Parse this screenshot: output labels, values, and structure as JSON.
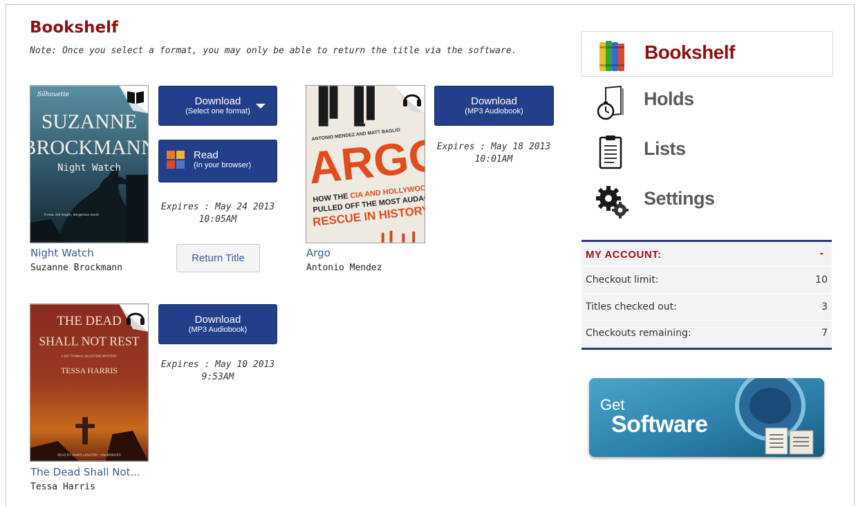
{
  "page": {
    "title": "Bookshelf",
    "note": "Note: Once you select a format, you may only be able to return the title via the software."
  },
  "books": [
    {
      "title": "Night Watch",
      "author": "Suzanne Brockmann",
      "format_icon": "ebook-icon",
      "cover": {
        "line1": "SUZANNE",
        "line2": "BROCKMANN",
        "line3": "Night Watch",
        "publisher": "Silhouette",
        "tag": "A new, full-length, dangerous novel"
      },
      "download": {
        "label": "Download",
        "sub": "(Select one format)"
      },
      "read": {
        "label": "Read",
        "sub": "(In your browser)"
      },
      "expires": {
        "line1": "Expires : May 24 2013",
        "line2": "10:05AM"
      },
      "return_label": "Return Title"
    },
    {
      "title": "Argo",
      "author": "Antonio Mendez",
      "format_icon": "headphones-icon",
      "cover": {
        "authors": "ANTONIO MENDEZ AND MATT BAGLIO",
        "big": "ARGO",
        "sub1a": "HOW THE ",
        "sub1b": "CIA AND HOLLYWOOD",
        "sub2": "PULLED OFF THE MOST AUDACIOUS",
        "sub3": "RESCUE IN HISTORY"
      },
      "download": {
        "label": "Download",
        "sub": "(MP3 Audiobook)"
      },
      "expires": {
        "line1": "Expires : May 18 2013",
        "line2": "10:01AM"
      }
    },
    {
      "title": "The Dead Shall Not...",
      "author": "Tessa Harris",
      "format_icon": "headphones-icon",
      "cover": {
        "line1": "THE DEAD",
        "line2": "SHALL NOT REST",
        "line3": "A DR. THOMAS SILKSTONE MYSTERY",
        "line4": "TESSA HARRIS",
        "reader": "READ BY JAMES LANGTON · UNABRIDGED"
      },
      "download": {
        "label": "Download",
        "sub": "(MP3 Audiobook)"
      },
      "expires": {
        "line1": "Expires : May 10 2013",
        "line2": "9:53AM"
      }
    }
  ],
  "sidebar": {
    "nav": [
      {
        "label": "Bookshelf",
        "icon": "books-icon",
        "active": true
      },
      {
        "label": "Holds",
        "icon": "stopwatch-book-icon",
        "active": false
      },
      {
        "label": "Lists",
        "icon": "clipboard-icon",
        "active": false
      },
      {
        "label": "Settings",
        "icon": "gears-icon",
        "active": false
      }
    ],
    "account": {
      "heading": "MY ACCOUNT:",
      "toggle": "-",
      "rows": [
        {
          "label": "Checkout limit:",
          "value": "10"
        },
        {
          "label": "Titles checked out:",
          "value": "3"
        },
        {
          "label": "Checkouts remaining:",
          "value": "7"
        }
      ]
    },
    "software": {
      "get": "Get",
      "main": "Software"
    }
  },
  "colors": {
    "title_red": "#8b1010",
    "button_blue": "#243f8a",
    "link_blue": "#3a5a94",
    "account_rule": "#2a3a7a"
  }
}
